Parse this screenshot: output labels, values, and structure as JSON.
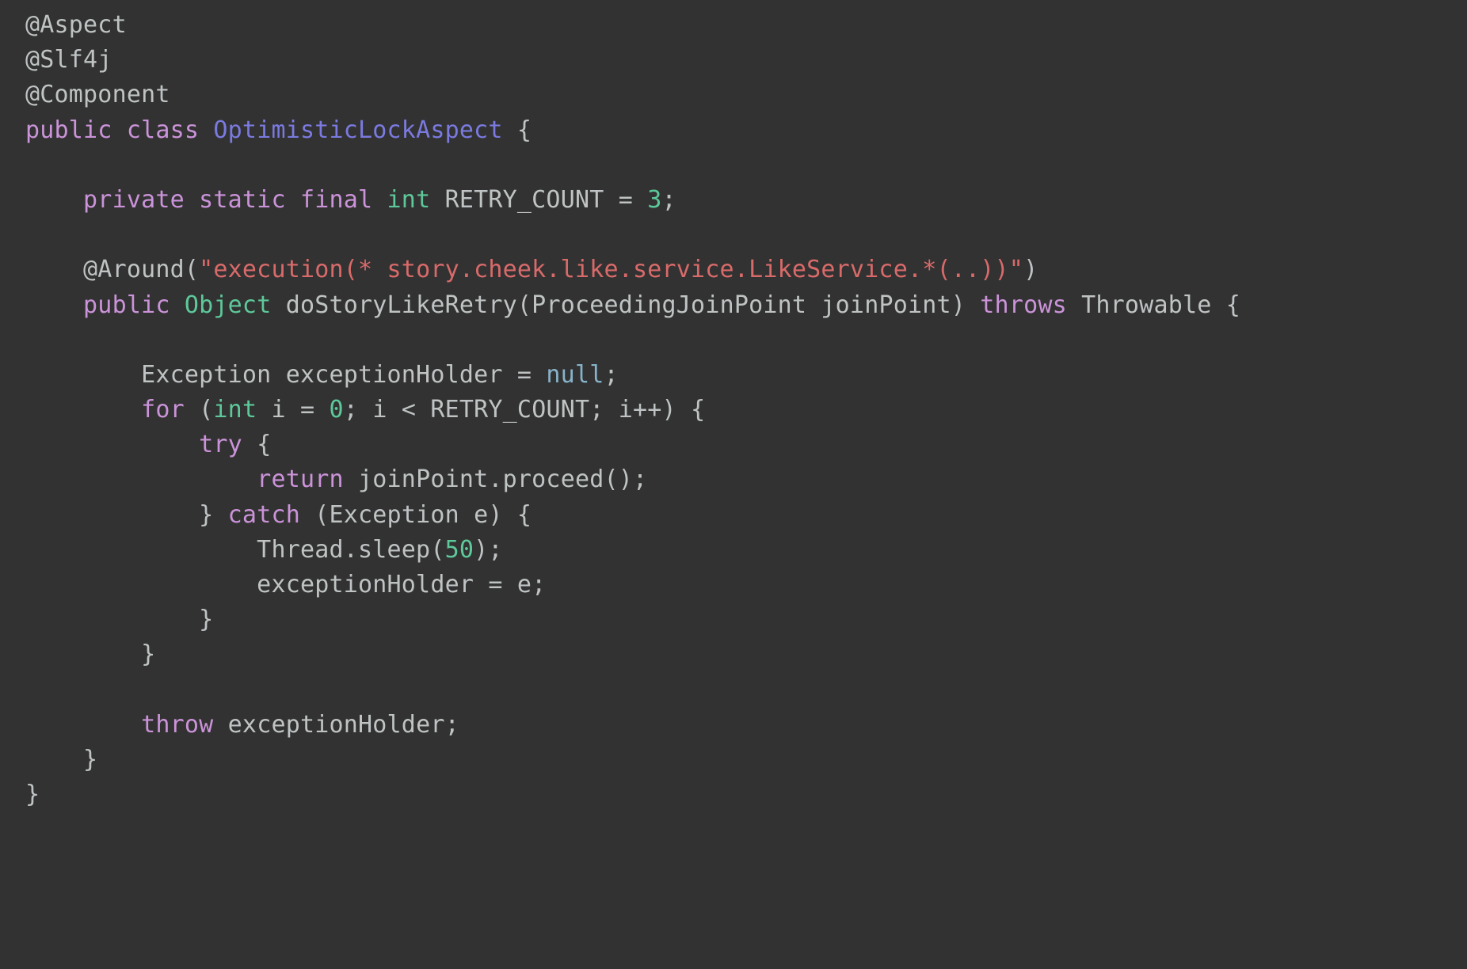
{
  "editor": {
    "language": "Java",
    "theme": "dark",
    "background_color": "#323232",
    "default_text_color": "#bfc3c4",
    "colors": {
      "keyword": "#cb93d9",
      "type": "#5dc99a",
      "class_name": "#7a7ae0",
      "string": "#d96a6a",
      "number": "#5dc99a",
      "null_literal": "#87b3c9",
      "identifier": "#bfc3c4",
      "annotation": "#bfc3c4"
    },
    "lines": [
      {
        "n": 1,
        "text": "@Aspect",
        "tokens": [
          {
            "t": "@Aspect",
            "c": "annot"
          }
        ]
      },
      {
        "n": 2,
        "text": "@Slf4j",
        "tokens": [
          {
            "t": "@Slf4j",
            "c": "annot"
          }
        ]
      },
      {
        "n": 3,
        "text": "@Component",
        "tokens": [
          {
            "t": "@Component",
            "c": "annot"
          }
        ]
      },
      {
        "n": 4,
        "text": "public class OptimisticLockAspect {",
        "tokens": [
          {
            "t": "public class ",
            "c": "keyword"
          },
          {
            "t": "OptimisticLockAspect",
            "c": "classname"
          },
          {
            "t": " {",
            "c": "default"
          }
        ]
      },
      {
        "n": 5,
        "text": "",
        "tokens": []
      },
      {
        "n": 6,
        "text": "    private static final int RETRY_COUNT = 3;",
        "tokens": [
          {
            "t": "    ",
            "c": "default"
          },
          {
            "t": "private static final ",
            "c": "keyword"
          },
          {
            "t": "int",
            "c": "type"
          },
          {
            "t": " RETRY_COUNT = ",
            "c": "default"
          },
          {
            "t": "3",
            "c": "number"
          },
          {
            "t": ";",
            "c": "default"
          }
        ]
      },
      {
        "n": 7,
        "text": "",
        "tokens": []
      },
      {
        "n": 8,
        "text": "    @Around(\"execution(* story.cheek.like.service.LikeService.*(..))\")",
        "tokens": [
          {
            "t": "    ",
            "c": "default"
          },
          {
            "t": "@Around(",
            "c": "annot"
          },
          {
            "t": "\"execution(* story.cheek.like.service.LikeService.*(..))\"",
            "c": "string"
          },
          {
            "t": ")",
            "c": "annot"
          }
        ]
      },
      {
        "n": 9,
        "text": "    public Object doStoryLikeRetry(ProceedingJoinPoint joinPoint) throws Throwable {",
        "tokens": [
          {
            "t": "    ",
            "c": "default"
          },
          {
            "t": "public ",
            "c": "keyword"
          },
          {
            "t": "Object",
            "c": "type"
          },
          {
            "t": " doStoryLikeRetry(ProceedingJoinPoint joinPoint) ",
            "c": "default"
          },
          {
            "t": "throws",
            "c": "keyword"
          },
          {
            "t": " Throwable {",
            "c": "default"
          }
        ]
      },
      {
        "n": 10,
        "text": "",
        "tokens": []
      },
      {
        "n": 11,
        "text": "        Exception exceptionHolder = null;",
        "tokens": [
          {
            "t": "        Exception exceptionHolder = ",
            "c": "default"
          },
          {
            "t": "null",
            "c": "null"
          },
          {
            "t": ";",
            "c": "default"
          }
        ]
      },
      {
        "n": 12,
        "text": "        for (int i = 0; i < RETRY_COUNT; i++) {",
        "tokens": [
          {
            "t": "        ",
            "c": "default"
          },
          {
            "t": "for",
            "c": "keyword"
          },
          {
            "t": " (",
            "c": "default"
          },
          {
            "t": "int",
            "c": "type"
          },
          {
            "t": " i = ",
            "c": "default"
          },
          {
            "t": "0",
            "c": "number"
          },
          {
            "t": "; i < RETRY_COUNT; i++) {",
            "c": "default"
          }
        ]
      },
      {
        "n": 13,
        "text": "            try {",
        "tokens": [
          {
            "t": "            ",
            "c": "default"
          },
          {
            "t": "try",
            "c": "keyword"
          },
          {
            "t": " {",
            "c": "default"
          }
        ]
      },
      {
        "n": 14,
        "text": "                return joinPoint.proceed();",
        "tokens": [
          {
            "t": "                ",
            "c": "default"
          },
          {
            "t": "return",
            "c": "keyword"
          },
          {
            "t": " joinPoint.proceed();",
            "c": "default"
          }
        ]
      },
      {
        "n": 15,
        "text": "            } catch (Exception e) {",
        "tokens": [
          {
            "t": "            } ",
            "c": "default"
          },
          {
            "t": "catch",
            "c": "keyword"
          },
          {
            "t": " (Exception e) {",
            "c": "default"
          }
        ]
      },
      {
        "n": 16,
        "text": "                Thread.sleep(50);",
        "tokens": [
          {
            "t": "                Thread.sleep(",
            "c": "default"
          },
          {
            "t": "50",
            "c": "number"
          },
          {
            "t": ");",
            "c": "default"
          }
        ]
      },
      {
        "n": 17,
        "text": "                exceptionHolder = e;",
        "tokens": [
          {
            "t": "                exceptionHolder = e;",
            "c": "default"
          }
        ]
      },
      {
        "n": 18,
        "text": "            }",
        "tokens": [
          {
            "t": "            }",
            "c": "default"
          }
        ]
      },
      {
        "n": 19,
        "text": "        }",
        "tokens": [
          {
            "t": "        }",
            "c": "default"
          }
        ]
      },
      {
        "n": 20,
        "text": "",
        "tokens": []
      },
      {
        "n": 21,
        "text": "        throw exceptionHolder;",
        "tokens": [
          {
            "t": "        ",
            "c": "default"
          },
          {
            "t": "throw",
            "c": "keyword"
          },
          {
            "t": " exceptionHolder;",
            "c": "default"
          }
        ]
      },
      {
        "n": 22,
        "text": "    }",
        "tokens": [
          {
            "t": "    }",
            "c": "default"
          }
        ]
      },
      {
        "n": 23,
        "text": "}",
        "tokens": [
          {
            "t": "}",
            "c": "default"
          }
        ]
      }
    ]
  }
}
